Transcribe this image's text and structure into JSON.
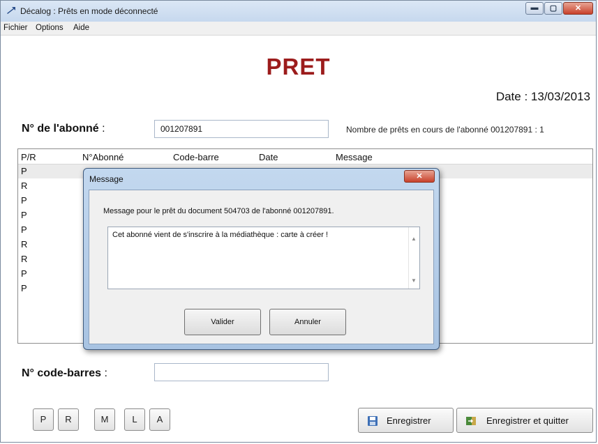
{
  "window": {
    "title": "Décalog : Prêts en mode déconnecté",
    "controls": {
      "minimize_glyph": "▬",
      "maximize_glyph": "▢",
      "close_glyph": "✕"
    }
  },
  "menu": [
    "Fichier",
    "Options",
    "Aide"
  ],
  "header": {
    "title": "PRET",
    "date_label": "Date : 13/03/2013"
  },
  "subscriber": {
    "label": "N° de l'abonné",
    "colon": ":",
    "value": "001207891",
    "loan_count_text": "Nombre de prêts en cours de l'abonné 001207891 : 1"
  },
  "grid": {
    "columns": [
      "P/R",
      "N°Abonné",
      "Code-barre",
      "Date",
      "Message"
    ],
    "rows": [
      "P",
      "R",
      "P",
      "P",
      "P",
      "R",
      "R",
      "P",
      "P"
    ]
  },
  "dialog": {
    "title": "Message",
    "close_glyph": "✕",
    "message_line": "Message pour le prêt du document 504703 de l'abonné 001207891.",
    "message_text": "Cet abonné vient de s'inscrire à la médiathèque : carte à créer !",
    "scroll_up": "▲",
    "scroll_down": "▼",
    "ok_label": "Valider",
    "cancel_label": "Annuler"
  },
  "barcode": {
    "label": "N° code-barres",
    "colon": ":",
    "value": ""
  },
  "shortcuts": [
    "P",
    "R",
    "M",
    "L",
    "A"
  ],
  "actions": {
    "save_label": "Enregistrer",
    "save_quit_label": "Enregistrer et quitter"
  },
  "colors": {
    "title_red": "#9c1c1c",
    "close_red": "#c8412b",
    "dialog_frame": "#a8c3e2"
  }
}
